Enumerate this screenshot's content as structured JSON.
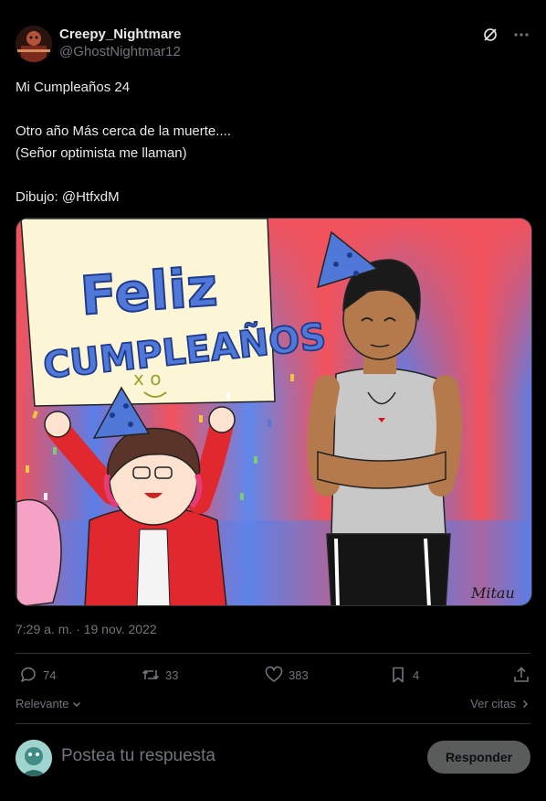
{
  "author": {
    "display_name": "Creepy_Nightmare",
    "handle": "@GhostNightmar12"
  },
  "tweet": {
    "text": "Mi Cumpleaños 24\n\nOtro año Más cerca de la muerte....\n(Señor optimista me llaman)\n\nDibujo: @HtfxdM",
    "timestamp": "7:29 a. m. · 19 nov. 2022"
  },
  "media": {
    "banner_line1": "Feliz",
    "banner_line2": "CUMPLEAÑOS",
    "banner_face": "x o",
    "signature": "Mitau"
  },
  "stats": {
    "replies": "74",
    "retweets": "33",
    "likes": "383",
    "bookmarks": "4"
  },
  "meta": {
    "sort_label": "Relevante",
    "quotes_label": "Ver citas"
  },
  "reply": {
    "placeholder": "Postea tu respuesta",
    "button_label": "Responder"
  },
  "colors": {
    "background": "#000000",
    "text_primary": "#e7e9ea",
    "text_secondary": "#71767b",
    "divider": "#2f3336"
  }
}
